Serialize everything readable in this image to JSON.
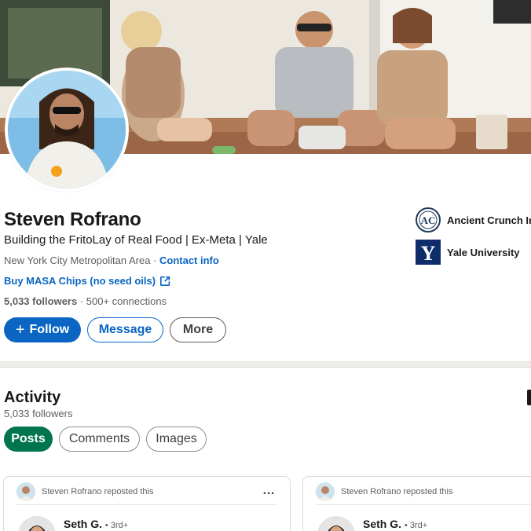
{
  "profile": {
    "name": "Steven Rofrano",
    "headline": "Building the FritoLay of Real Food | Ex-Meta | Yale",
    "location": "New York City Metropolitan Area",
    "separator": " · ",
    "contact_label": "Contact info",
    "external_link": "Buy MASA Chips (no seed oils)",
    "followers_count": "5,033 followers",
    "connections": "· 500+ connections"
  },
  "actions": {
    "follow_label": "Follow",
    "follow_prefix": "+",
    "message_label": "Message",
    "more_label": "More"
  },
  "organizations": [
    {
      "name": "Ancient Crunch Inc",
      "logo_text": "AC",
      "color": "#1f3a5a"
    },
    {
      "name": "Yale University",
      "logo_text": "Y",
      "color": "#0f2d6b"
    }
  ],
  "activity": {
    "title": "Activity",
    "followers": "5,033 followers",
    "tabs": [
      {
        "label": "Posts",
        "selected": true
      },
      {
        "label": "Comments",
        "selected": false
      },
      {
        "label": "Images",
        "selected": false
      }
    ]
  },
  "posts": [
    {
      "repost_text": "Steven Rofrano reposted this",
      "more_icon": "…",
      "author_name": "Seth G.",
      "author_degree": "• 3rd+"
    },
    {
      "repost_text": "Steven Rofrano reposted this",
      "author_name": "Seth G.",
      "author_degree": "• 3rd+"
    }
  ],
  "colors": {
    "primary_blue": "#0a66c2",
    "posts_green": "#01754f",
    "muted_text": "#5e5e5e"
  }
}
